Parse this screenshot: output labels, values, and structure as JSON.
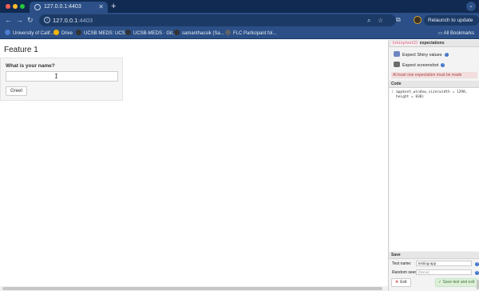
{
  "browser": {
    "tab_title": "127.0.0.1:4403",
    "new_tab_symbol": "+",
    "url_host": "127.0.0.1",
    "url_port": ":4403",
    "relaunch_label": "Relaunch to update",
    "bookmarks": [
      {
        "label": "University of Calif...",
        "color": "#4d7dd0"
      },
      {
        "label": "Drive",
        "color": "#f4b400"
      },
      {
        "label": "UCSB MEDS: UCS...",
        "color": "#333333"
      },
      {
        "label": "UCSB-MEDS · Git...",
        "color": "#333333"
      },
      {
        "label": "samanthacsik (Sa...",
        "color": "#333333"
      },
      {
        "label": "FLC Participant fol...",
        "color": "#5f6368"
      }
    ],
    "all_bookmarks_label": "All Bookmarks"
  },
  "app": {
    "title": "Feature 1",
    "name_label": "What is your name?",
    "name_value": "",
    "greet_label": "Greet"
  },
  "panel": {
    "header_tag": "{shinytest2}",
    "header_label": "expectations",
    "expect_values_label": "Expect Shiny values",
    "expect_screenshot_label": "Expect screenshot",
    "warning": "At least one expectation must be made",
    "code_header": "Code",
    "code_line_number": "1",
    "code_text": "app$set_window_size(width = 1298, height = 838)",
    "save_header": "Save",
    "test_name_label": "Test name:",
    "test_name_value": "testing-app",
    "seed_label": "Random seed:",
    "seed_placeholder": "(None)",
    "exit_label": "Exit",
    "save_exit_label": "Save test and exit",
    "colors": {
      "warning_bg": "#f2dede",
      "warning_text": "#a94442",
      "save_bg": "#dff0d8",
      "help_icon": "#3b6fc9"
    }
  }
}
